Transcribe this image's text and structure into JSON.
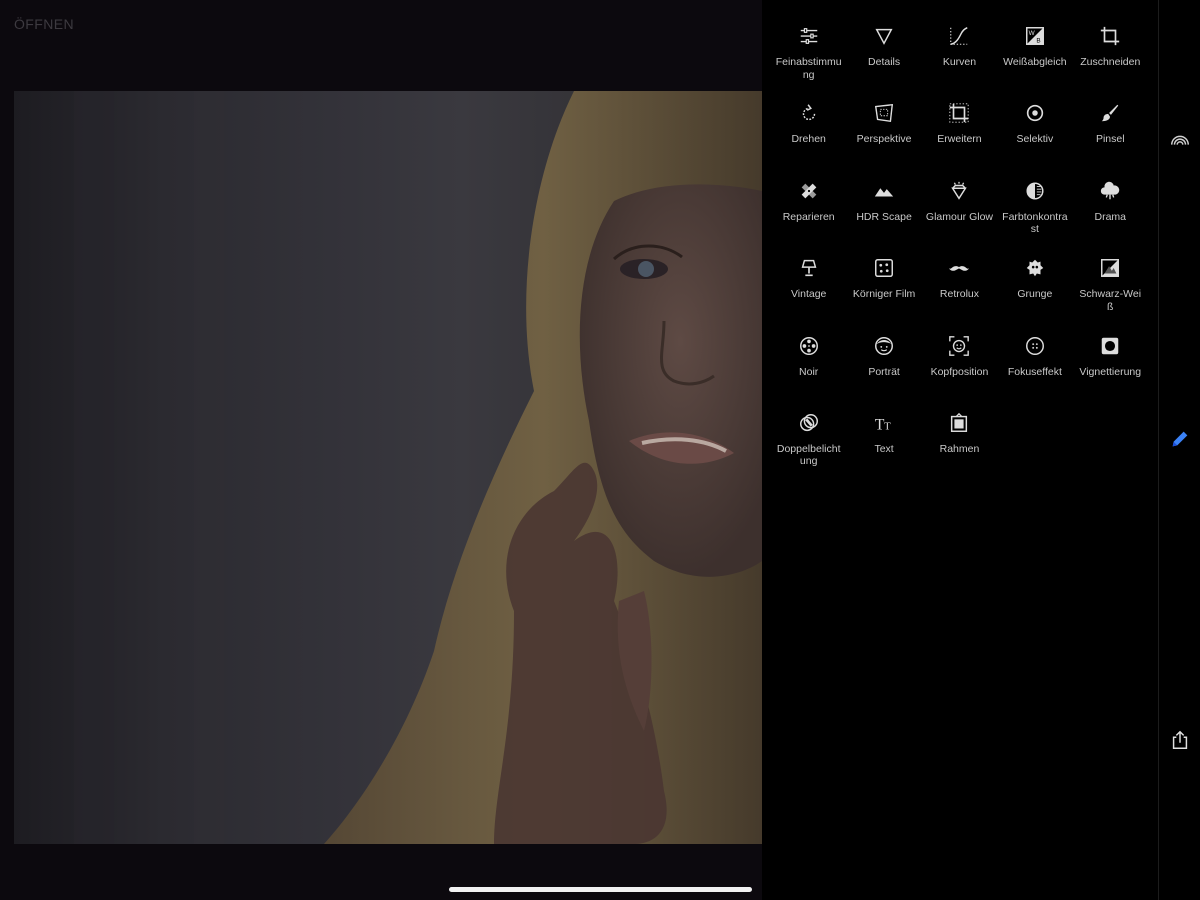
{
  "header": {
    "open_label": "ÖFFNEN"
  },
  "tools": [
    {
      "label": "Feinabstimmung",
      "icon": "sliders-icon"
    },
    {
      "label": "Details",
      "icon": "triangle-down-icon"
    },
    {
      "label": "Kurven",
      "icon": "curves-icon"
    },
    {
      "label": "Weißabgleich",
      "icon": "white-balance-icon"
    },
    {
      "label": "Zuschneiden",
      "icon": "crop-icon"
    },
    {
      "label": "Drehen",
      "icon": "rotate-icon"
    },
    {
      "label": "Perspektive",
      "icon": "perspective-icon"
    },
    {
      "label": "Erweitern",
      "icon": "expand-icon"
    },
    {
      "label": "Selektiv",
      "icon": "selective-icon"
    },
    {
      "label": "Pinsel",
      "icon": "brush-icon"
    },
    {
      "label": "Reparieren",
      "icon": "bandage-icon"
    },
    {
      "label": "HDR Scape",
      "icon": "mountains-icon"
    },
    {
      "label": "Glamour Glow",
      "icon": "diamond-icon"
    },
    {
      "label": "Farbtonkontrast",
      "icon": "tonal-contrast-icon"
    },
    {
      "label": "Drama",
      "icon": "cloud-icon"
    },
    {
      "label": "Vintage",
      "icon": "lamp-icon"
    },
    {
      "label": "Körniger Film",
      "icon": "grain-icon"
    },
    {
      "label": "Retrolux",
      "icon": "mustache-icon"
    },
    {
      "label": "Grunge",
      "icon": "grunge-icon"
    },
    {
      "label": "Schwarz-Weiß",
      "icon": "black-white-icon"
    },
    {
      "label": "Noir",
      "icon": "film-reel-icon"
    },
    {
      "label": "Porträt",
      "icon": "face-icon"
    },
    {
      "label": "Kopfposition",
      "icon": "head-pose-icon"
    },
    {
      "label": "Fokuseffekt",
      "icon": "focus-icon"
    },
    {
      "label": "Vignettierung",
      "icon": "vignette-icon"
    },
    {
      "label": "Doppelbelichtung",
      "icon": "double-exposure-icon"
    },
    {
      "label": "Text",
      "icon": "text-icon"
    },
    {
      "label": "Rahmen",
      "icon": "frame-icon"
    }
  ],
  "rail": [
    {
      "name": "looks-button",
      "icon": "looks-icon"
    },
    {
      "name": "tools-button",
      "icon": "pencil-icon",
      "active": true
    },
    {
      "name": "export-button",
      "icon": "share-icon"
    }
  ],
  "colors": {
    "accent": "#3b82f6",
    "panel": "#000000",
    "label": "#c9c9c9"
  }
}
